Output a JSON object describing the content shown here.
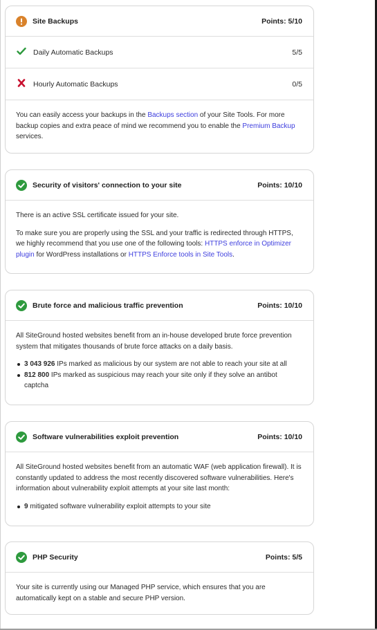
{
  "backups": {
    "title": "Site Backups",
    "points": "Points: 5/10",
    "rows": [
      {
        "label": "Daily Automatic Backups",
        "points": "5/5"
      },
      {
        "label": "Hourly Automatic Backups",
        "points": "0/5"
      }
    ],
    "body": {
      "t1": "You can easily access your backups in the ",
      "link1": "Backups section",
      "t2": " of your Site Tools. For more backup copies and extra peace of mind we recommend you to enable the ",
      "link2": "Premium Backup",
      "t3": " services."
    }
  },
  "ssl": {
    "title": "Security of visitors' connection to your site",
    "points": "Points: 10/10",
    "p1": "There is an active SSL certificate issued for your site.",
    "p2": {
      "t1": "To make sure you are properly using the SSL and your traffic is redirected through HTTPS, we highly recommend that you use one of the following tools: ",
      "link1": "HTTPS enforce in Optimizer plugin",
      "t2": " for WordPress installations or ",
      "link2": "HTTPS Enforce tools in Site Tools",
      "t3": "."
    }
  },
  "brute": {
    "title": "Brute force and malicious traffic prevention",
    "points": "Points: 10/10",
    "p1": "All SiteGround hosted websites benefit from an in-house developed brute force prevention system that mitigates thousands of brute force attacks on a daily basis.",
    "items": [
      {
        "num": "3 043 926",
        "text": " IPs marked as malicious by our system are not able to reach your site at all"
      },
      {
        "num": "812 800",
        "text": " IPs marked as suspicious may reach your site only if they solve an antibot captcha"
      }
    ]
  },
  "waf": {
    "title": "Software vulnerabilities exploit prevention",
    "points": "Points: 10/10",
    "p1": "All SiteGround hosted websites benefit from an automatic WAF (web application firewall). It is constantly updated to address the most recently discovered software vulnerabilities. Here's information about vulnerability exploit attempts at your site last month:",
    "items": [
      {
        "num": "9",
        "text": " mitigated software vulnerability exploit attempts to your site"
      }
    ]
  },
  "php": {
    "title": "PHP Security",
    "points": "Points: 5/5",
    "p1": "Your site is currently using our Managed PHP service, which ensures that you are automatically kept on a stable and secure PHP version."
  },
  "icons": {
    "ok": "check-circle-icon",
    "warn": "exclamation-circle-icon",
    "row_ok": "checkmark-icon",
    "row_fail": "cross-icon"
  },
  "colors": {
    "ok": "#2e9a3e",
    "warn": "#d9822b",
    "fail": "#c8102e",
    "link": "#3d3dde"
  }
}
